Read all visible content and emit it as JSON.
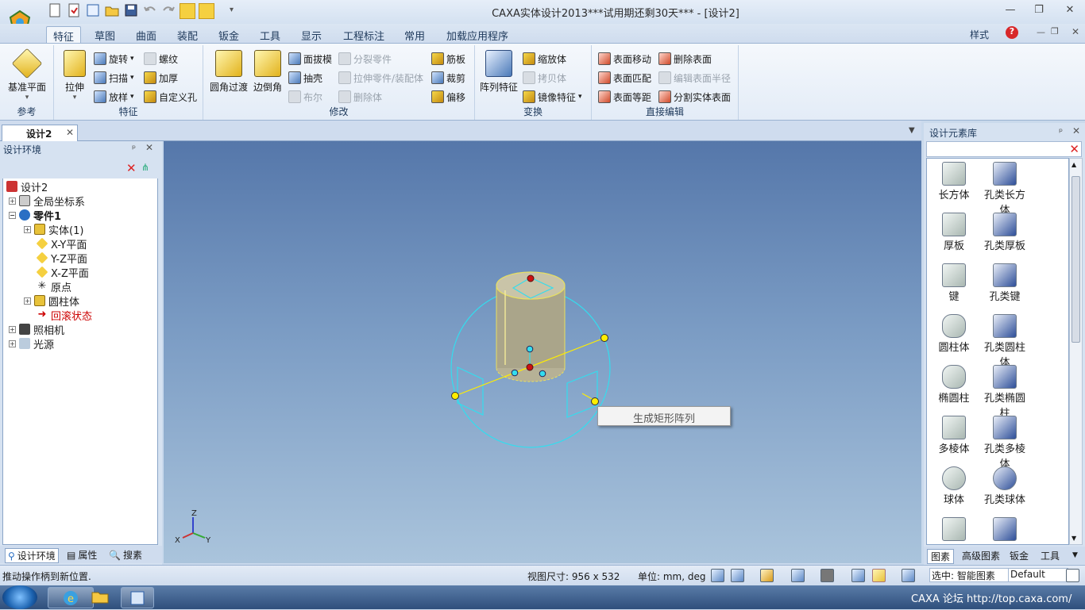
{
  "window": {
    "title": "CAXA实体设计2013***试用期还剩30天*** - [设计2]"
  },
  "ribbon": {
    "tabs": [
      "特征",
      "草图",
      "曲面",
      "装配",
      "钣金",
      "工具",
      "显示",
      "工程标注",
      "常用",
      "加载应用程序"
    ],
    "style_label": "样式",
    "groups": {
      "reference": {
        "label": "参考",
        "datum_plane": "基准平面"
      },
      "feature": {
        "label": "特征",
        "extrude": "拉伸",
        "revolve": "旋转",
        "sweep": "扫描",
        "loft": "放样",
        "thread": "螺纹",
        "thicken": "加厚",
        "custom_hole": "自定义孔"
      },
      "modify": {
        "label": "修改",
        "fillet": "圆角过渡",
        "chamfer": "边倒角",
        "face_draft": "面拔模",
        "shell": "抽壳",
        "boolean": "布尔",
        "split_part": "分裂零件",
        "extrude_to_part": "拉伸零件/装配体",
        "delete_body": "删除体",
        "rib": "筋板",
        "trim": "裁剪",
        "offset": "偏移"
      },
      "transform": {
        "label": "变换",
        "pattern": "阵列特征",
        "scale": "缩放体",
        "copy": "拷贝体",
        "mirror": "镜像特征"
      },
      "direct_edit": {
        "label": "直接编辑",
        "move_face": "表面移动",
        "match_face": "表面匹配",
        "equidistant_face": "表面等距",
        "delete_face": "删除表面",
        "edit_radius": "编辑表面半径",
        "split_face": "分割实体表面"
      }
    }
  },
  "document": {
    "tab_label": "设计2"
  },
  "design_env": {
    "header": "设计环境",
    "tree": [
      {
        "label": "设计2"
      },
      {
        "label": "全局坐标系"
      },
      {
        "label": "零件1"
      },
      {
        "label": "实体(1)"
      },
      {
        "label": "X-Y平面"
      },
      {
        "label": "Y-Z平面"
      },
      {
        "label": "X-Z平面"
      },
      {
        "label": "原点"
      },
      {
        "label": "圆柱体"
      },
      {
        "label": "回滚状态"
      },
      {
        "label": "照相机"
      },
      {
        "label": "光源"
      }
    ],
    "tabs": [
      "设计环境",
      "属性",
      "搜素"
    ]
  },
  "viewport": {
    "context_menu": "生成矩形阵列",
    "axes": {
      "x": "X",
      "y": "Y",
      "z": "Z"
    }
  },
  "library": {
    "header": "设计元素库",
    "items": [
      "长方体",
      "孔类长方体",
      "厚板",
      "孔类厚板",
      "键",
      "孔类键",
      "圆柱体",
      "孔类圆柱体",
      "椭圆柱",
      "孔类椭圆柱",
      "多棱体",
      "孔类多棱体",
      "球体",
      "孔类球体"
    ],
    "tabs": [
      "图素",
      "高级图素",
      "钣金",
      "工具"
    ]
  },
  "status": {
    "message": "推动操作柄到新位置.",
    "view_size": "视图尺寸: 956 x 532",
    "units": "单位: mm, deg",
    "select_mode": "选中: 智能图素",
    "style": "Default"
  },
  "taskbar": {
    "tray": "CAXA 论坛 http://top.caxa.com/"
  },
  "colors": {
    "accent": "#1e395b",
    "viewport_top": "#5577aa",
    "viewport_bottom": "#aac4dc",
    "handle_yellow": "#ffee00",
    "handle_cyan": "#33ddee",
    "hint_red": "#cc0000"
  }
}
